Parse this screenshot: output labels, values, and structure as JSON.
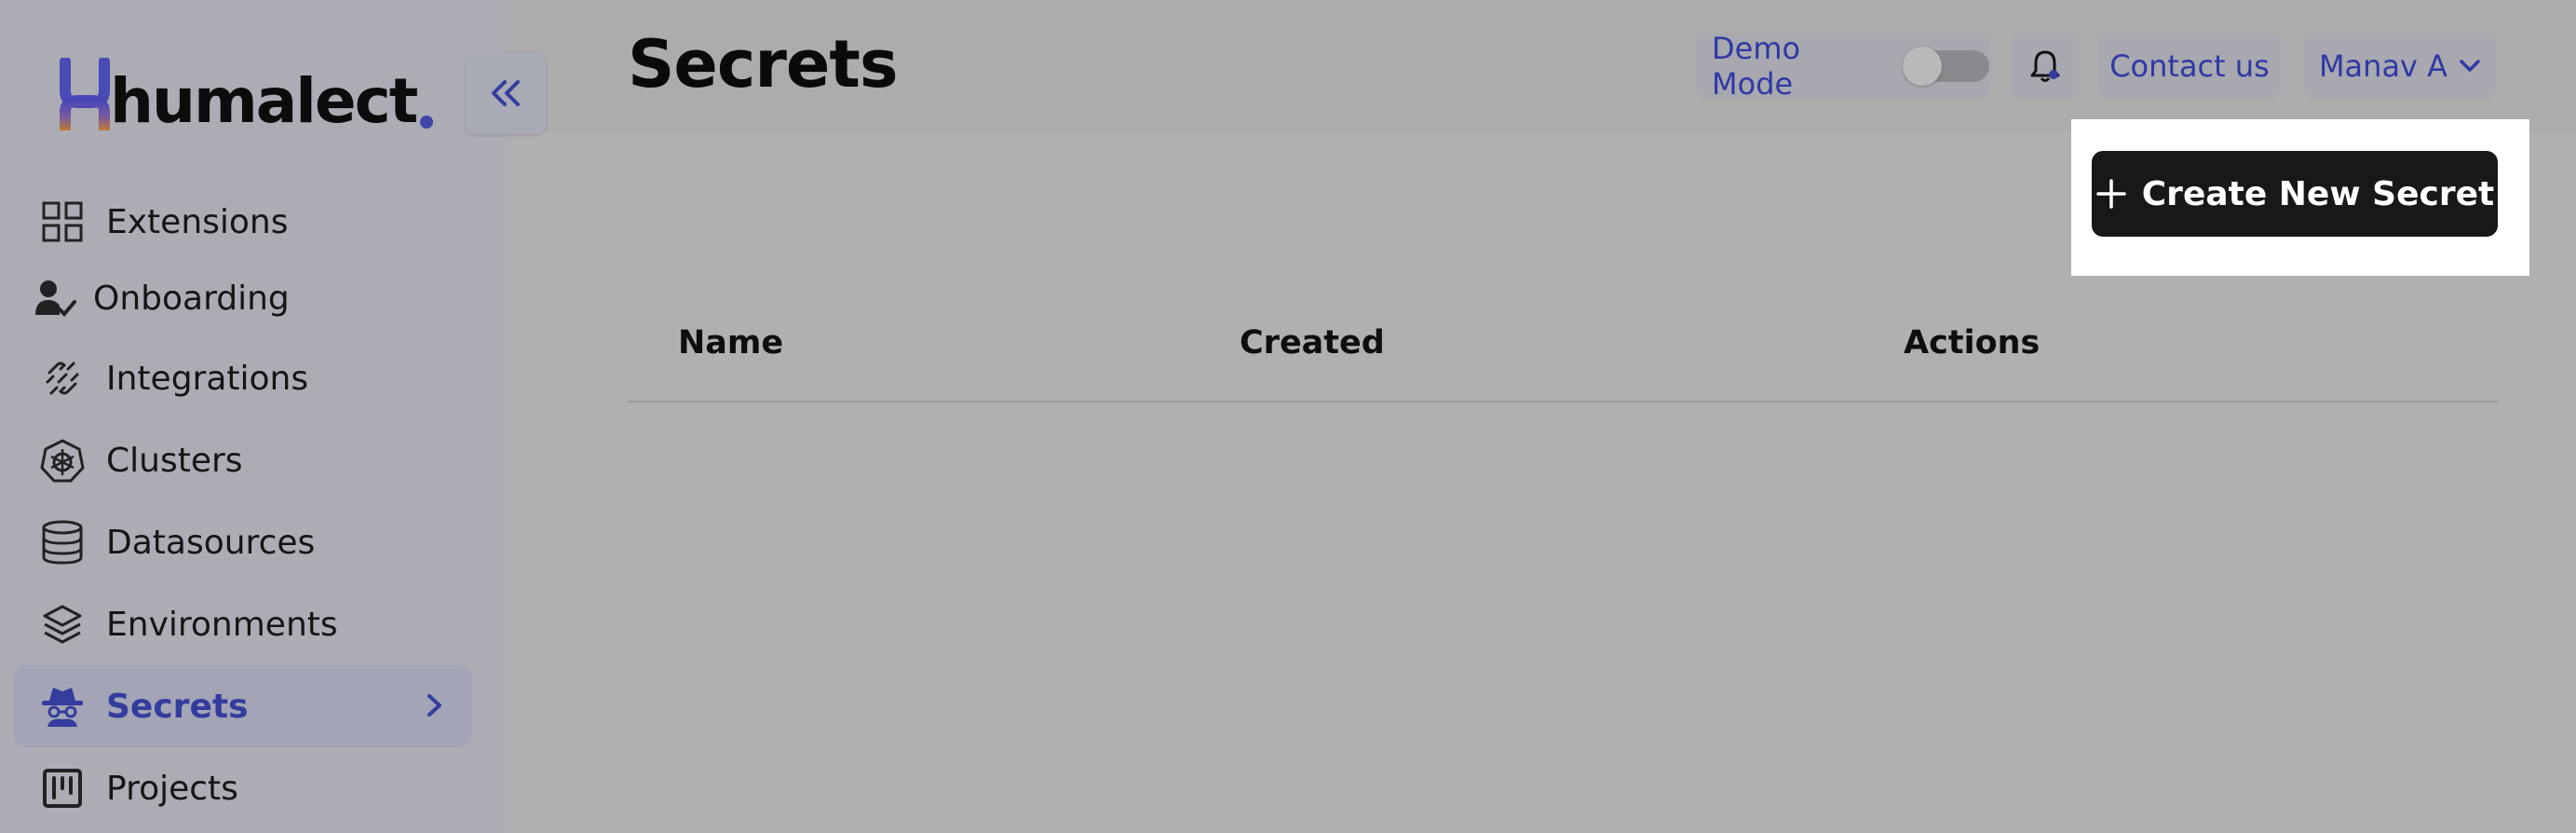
{
  "app": {
    "logo_text": "humalect"
  },
  "sidebar": {
    "items": [
      {
        "label": "Extensions",
        "icon": "grid-icon"
      },
      {
        "label": "Onboarding",
        "icon": "user-check-icon"
      },
      {
        "label": "Integrations",
        "icon": "integrations-icon"
      },
      {
        "label": "Clusters",
        "icon": "kubernetes-icon"
      },
      {
        "label": "Datasources",
        "icon": "database-icon"
      },
      {
        "label": "Environments",
        "icon": "layers-icon"
      },
      {
        "label": "Secrets",
        "icon": "spy-icon",
        "active": true
      },
      {
        "label": "Projects",
        "icon": "kanban-icon"
      }
    ]
  },
  "header": {
    "title": "Secrets",
    "demo_mode_label": "Demo Mode",
    "demo_mode_enabled": false,
    "contact_label": "Contact us",
    "user_label": "Manav A"
  },
  "actions": {
    "create_label": "Create New Secret"
  },
  "table": {
    "columns": [
      "Name",
      "Created",
      "Actions"
    ],
    "rows": []
  },
  "colors": {
    "accent": "#343c9e",
    "button_bg": "#18181b",
    "overlay": "#b0b0b0"
  }
}
